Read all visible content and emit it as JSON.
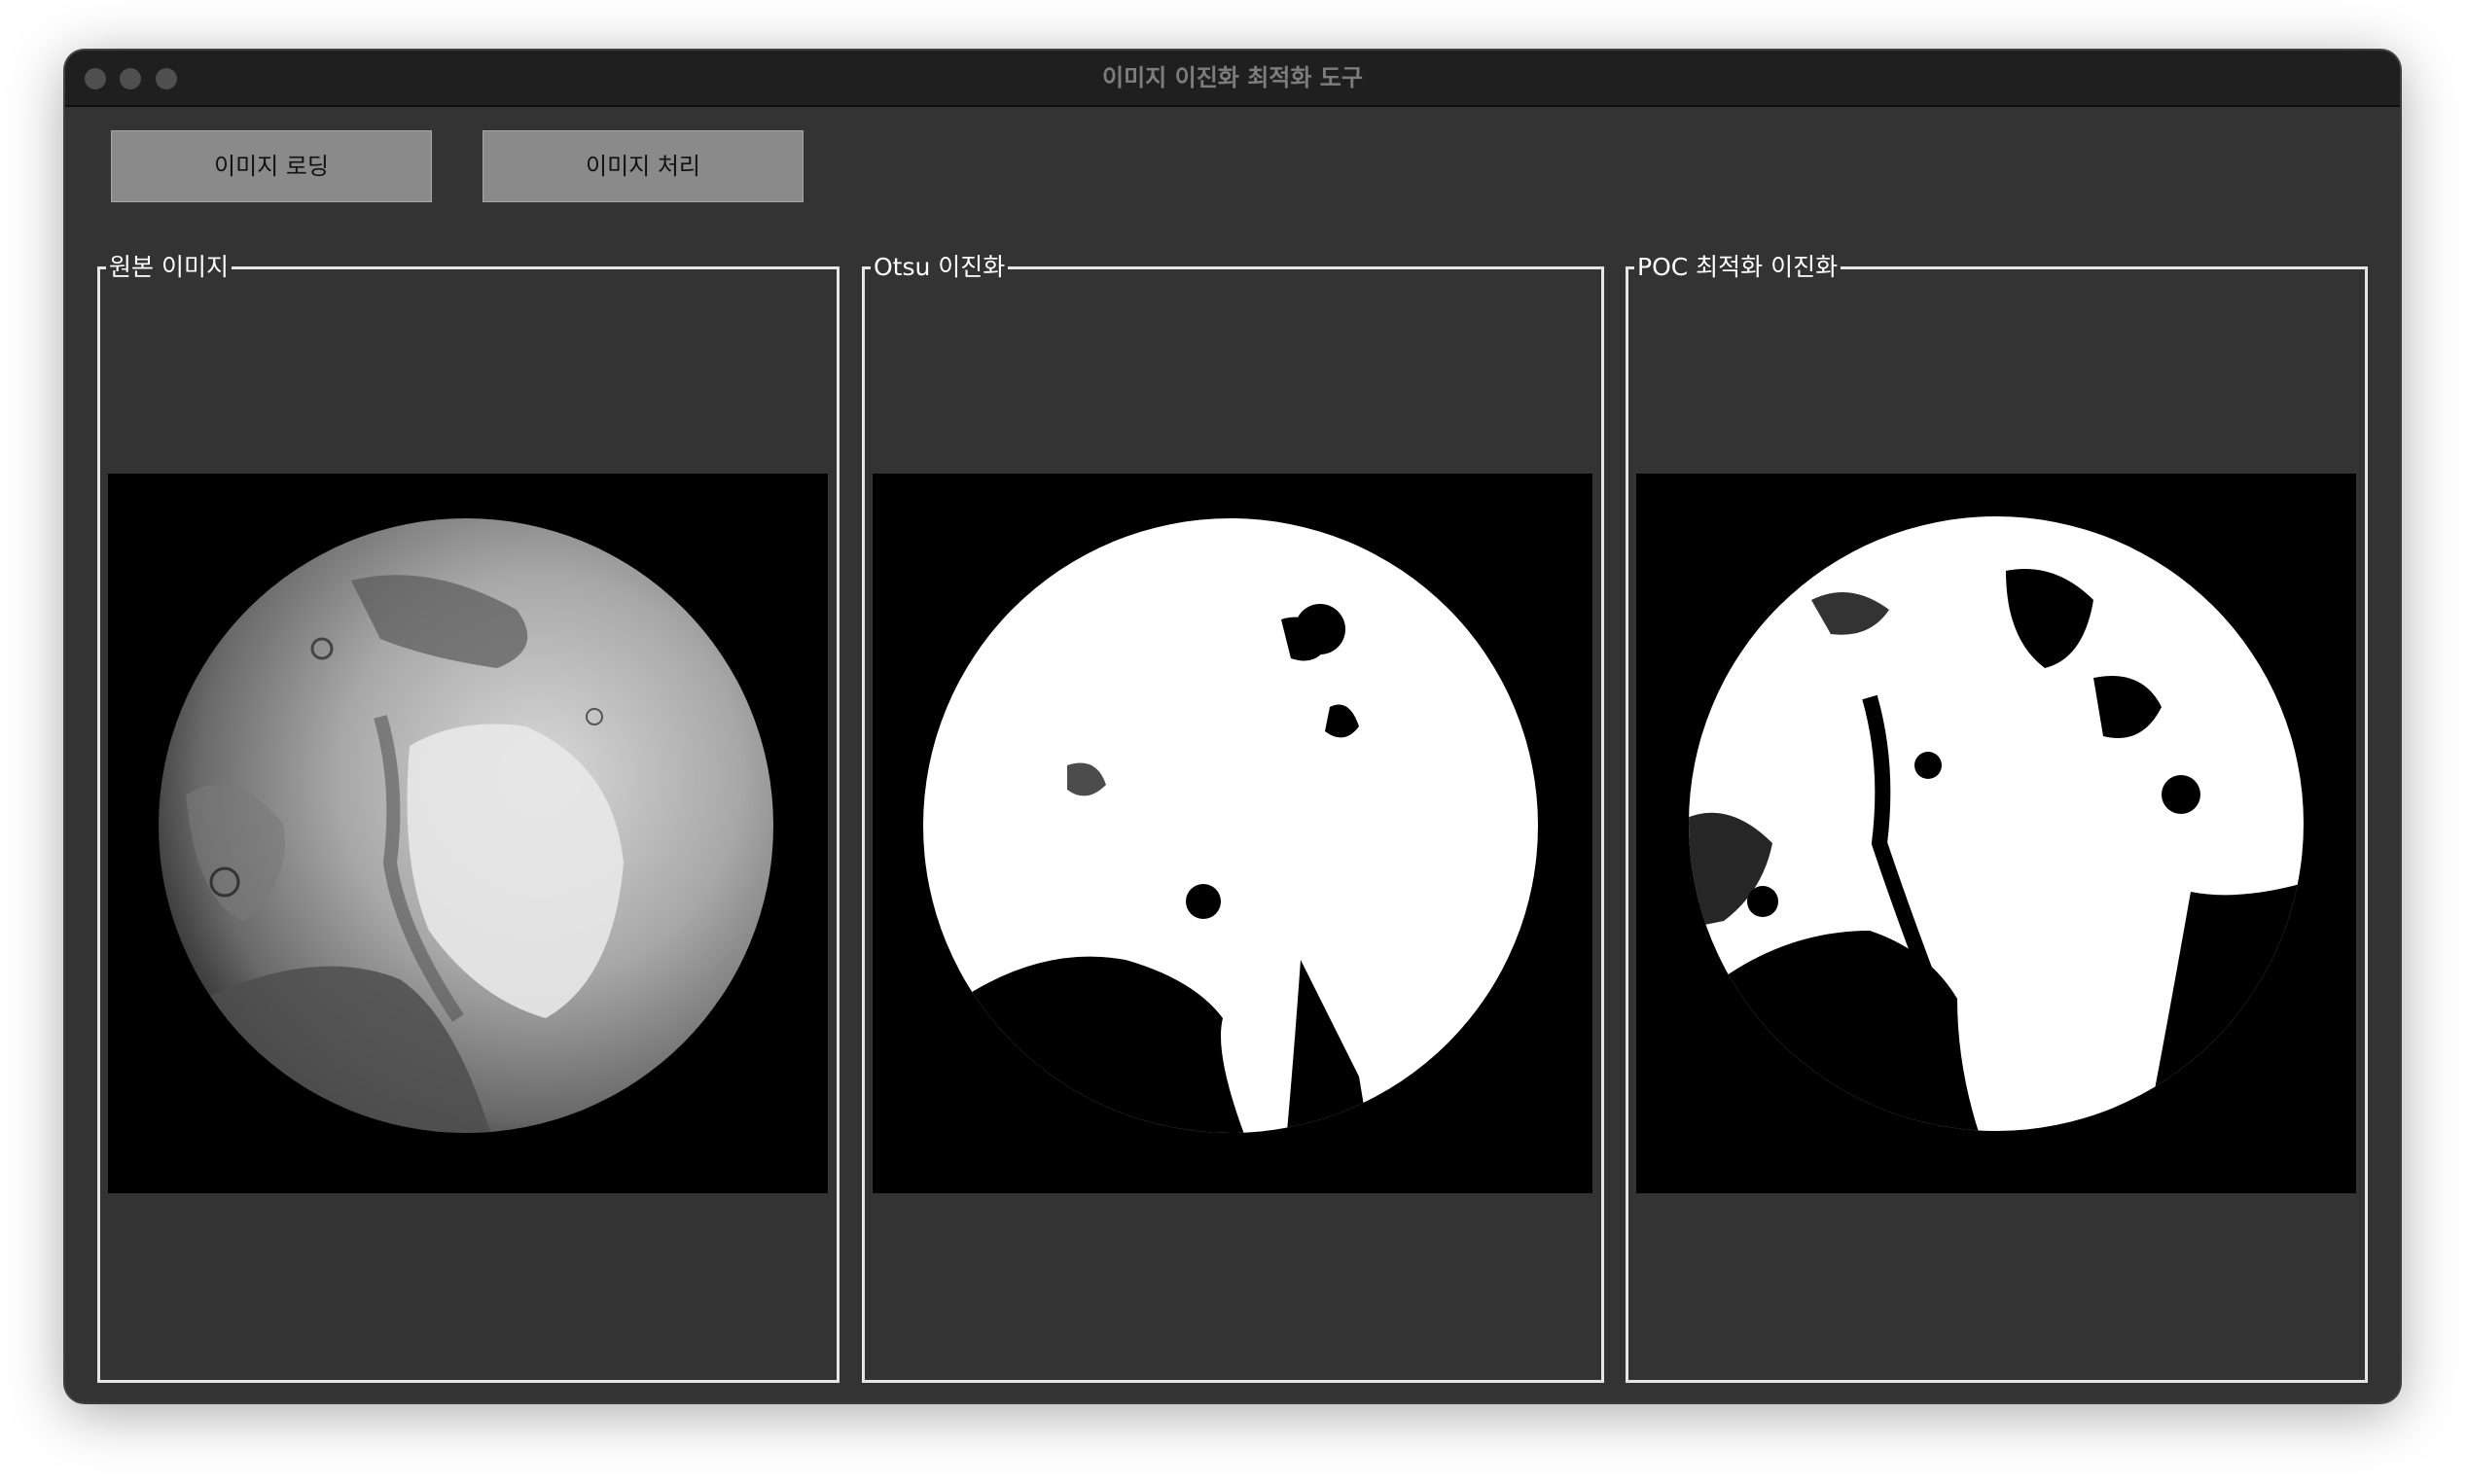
{
  "window": {
    "title": "이미지 이진화 최적화 도구"
  },
  "toolbar": {
    "load_label": "이미지 로딩",
    "process_label": "이미지 처리"
  },
  "panels": [
    {
      "label": "원본 이미지"
    },
    {
      "label": "Otsu 이진화"
    },
    {
      "label": "POC 최적화 이진화"
    }
  ],
  "icons": {
    "close": "traffic-light-close",
    "minimize": "traffic-light-minimize",
    "maximize": "traffic-light-maximize"
  }
}
